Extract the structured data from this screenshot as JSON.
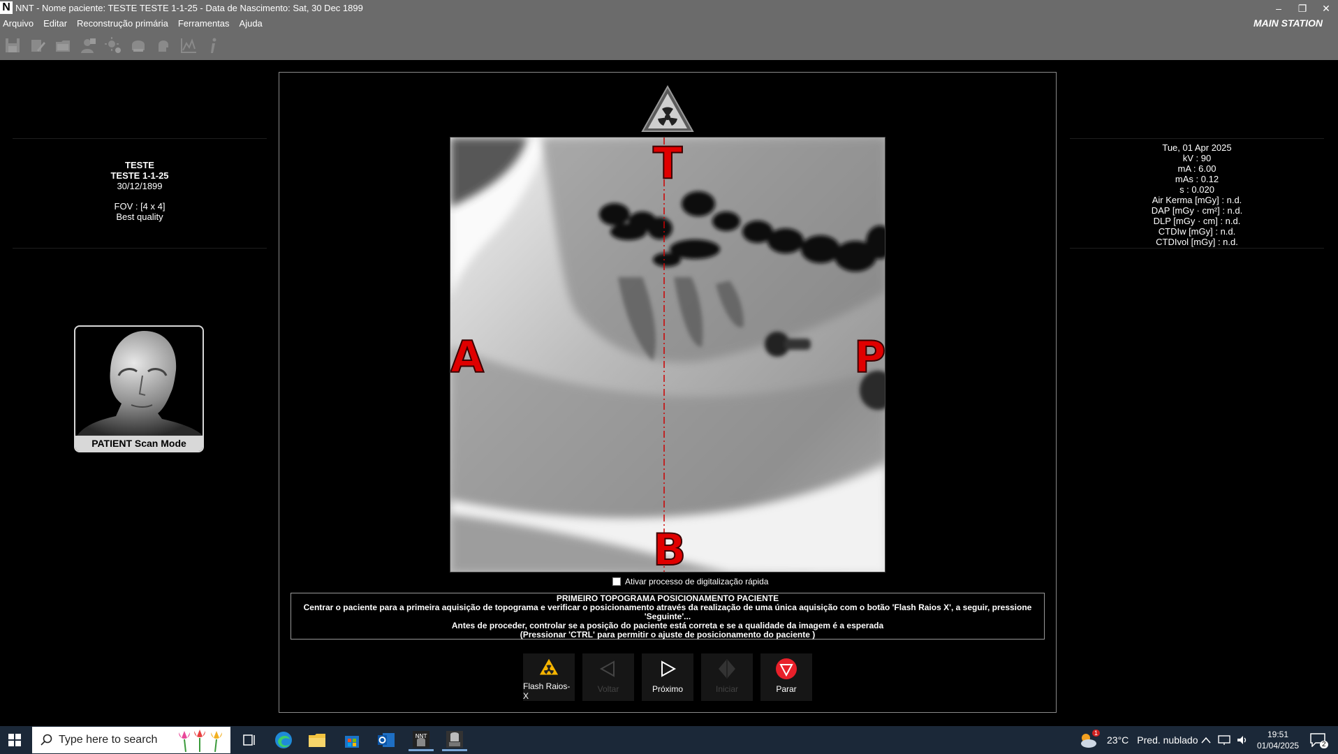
{
  "window": {
    "app_logo": "N",
    "title": "NNT - Nome paciente: TESTE TESTE 1-1-25 - Data de Nascimento: Sat, 30 Dec 1899",
    "station": "MAIN STATION",
    "controls": [
      "–",
      "❐",
      "✕"
    ]
  },
  "menu": {
    "items": [
      "Arquivo",
      "Editar",
      "Reconstrução primária",
      "Ferramentas",
      "Ajuda"
    ]
  },
  "toolbar": {
    "icons": [
      "save-icon",
      "edit-icon",
      "folder-icon",
      "patient-icon",
      "brightness-icon",
      "skull-icon",
      "head-icon",
      "chart-icon",
      "info-icon"
    ]
  },
  "patient": {
    "name": "TESTE",
    "id": "TESTE 1-1-25",
    "birth": "30/12/1899",
    "fov": "FOV : [4 x 4]",
    "quality": "Best quality"
  },
  "exposure": {
    "date": "Tue, 01 Apr 2025",
    "kv": "kV : 90",
    "ma": "mA : 6.00",
    "mas": "mAs : 0.12",
    "s": "s : 0.020",
    "air_kerma": "Air Kerma [mGy] : n.d.",
    "dap": "DAP [mGy · cm²] : n.d.",
    "dlp": "DLP [mGy · cm] : n.d.",
    "ctdiw": "CTDIw [mGy] : n.d.",
    "ctdivol": "CTDIvol [mGy] : n.d."
  },
  "mode": {
    "label": "PATIENT Scan Mode"
  },
  "orientation": {
    "top": "T",
    "bottom": "B",
    "left": "A",
    "right": "P"
  },
  "fast_scan": {
    "label": "Ativar processo de digitalização rápida",
    "checked": false
  },
  "instructions": {
    "title": "PRIMEIRO TOPOGRAMA POSICIONAMENTO PACIENTE",
    "line1": "Centrar o paciente para a primeira aquisição de topograma e verificar o posicionamento através da realização de uma única aquisição com o botão 'Flash Raios X', a seguir, pressione 'Seguinte'...",
    "line2": "Antes de proceder, controlar se a posição do paciente está correta e se a qualidade da imagem é a esperada",
    "line3": "(Pressionar 'CTRL' para permitir o ajuste de posicionamento do paciente )"
  },
  "actions": {
    "flash": "Flash Raios-X",
    "back": "Voltar",
    "next": "Próximo",
    "start": "Iniciar",
    "stop": "Parar"
  },
  "taskbar": {
    "search_placeholder": "Type here to search",
    "weather_temp": "23°C",
    "weather_text": "Pred. nublado",
    "weather_badge": "1",
    "time": "19:51",
    "date": "01/04/2025",
    "notifications": "2"
  },
  "colors": {
    "titlebar": "#6b6b6b",
    "orientation_label": "#e00000",
    "taskbar": "#1b2838"
  }
}
